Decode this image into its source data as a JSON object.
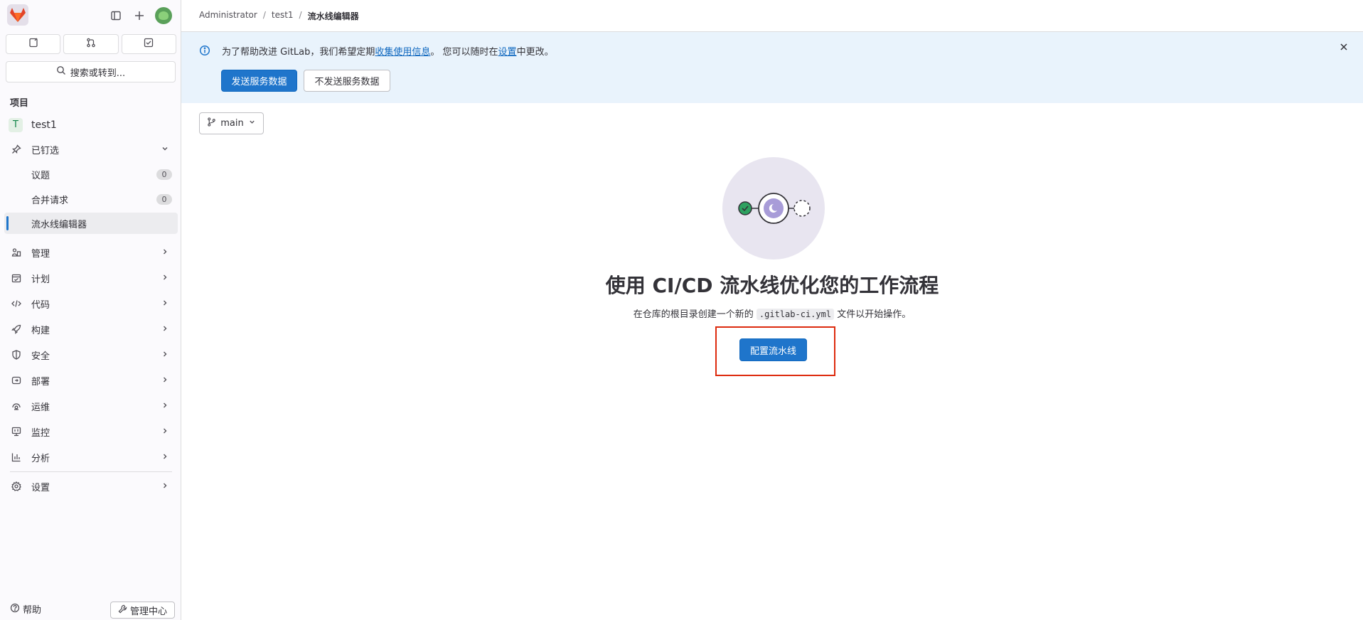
{
  "sidebar": {
    "quick_actions": [
      {
        "icon": "issues-icon"
      },
      {
        "icon": "merge-request-icon"
      },
      {
        "icon": "todo-icon"
      }
    ],
    "search_label": "搜索或转到...",
    "section_label": "项目",
    "project": {
      "letter": "T",
      "name": "test1"
    },
    "pinned": {
      "label": "已钉选",
      "items": [
        {
          "label": "议题",
          "count": "0"
        },
        {
          "label": "合并请求",
          "count": "0"
        },
        {
          "label": "流水线编辑器"
        }
      ]
    },
    "menu": [
      {
        "label": "管理",
        "icon": "manage-icon"
      },
      {
        "label": "计划",
        "icon": "plan-icon"
      },
      {
        "label": "代码",
        "icon": "code-icon"
      },
      {
        "label": "构建",
        "icon": "rocket-icon"
      },
      {
        "label": "安全",
        "icon": "shield-icon"
      },
      {
        "label": "部署",
        "icon": "deploy-icon"
      },
      {
        "label": "运维",
        "icon": "operate-icon"
      },
      {
        "label": "监控",
        "icon": "monitor-icon"
      },
      {
        "label": "分析",
        "icon": "chart-icon"
      }
    ],
    "settings_label": "设置",
    "help_label": "帮助",
    "admin_label": "管理中心"
  },
  "breadcrumb": {
    "items": [
      "Administrator",
      "test1"
    ],
    "current": "流水线编辑器"
  },
  "banner": {
    "text_before": "为了帮助改进 GitLab，我们希望定期",
    "link1": "收集使用信息",
    "text_middle": "。 您可以随时在",
    "link2": "设置",
    "text_after": "中更改。",
    "send_button": "发送服务数据",
    "dont_send_button": "不发送服务数据"
  },
  "branch": "main",
  "empty_state": {
    "title": "使用 CI/CD 流水线优化您的工作流程",
    "desc_before": "在仓库的根目录创建一个新的",
    "file": ".gitlab-ci.yml",
    "desc_after": "文件以开始操作。",
    "button": "配置流水线"
  }
}
